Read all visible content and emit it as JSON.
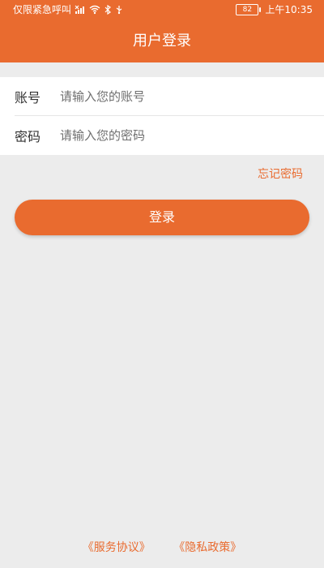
{
  "status_bar": {
    "carrier_text": "仅限紧急呼叫",
    "battery_level": "82",
    "time": "上午10:35",
    "icons": [
      "signal-x-icon",
      "wifi-icon",
      "bluetooth-icon",
      "usb-icon"
    ]
  },
  "header": {
    "title": "用户登录"
  },
  "form": {
    "account_label": "账号",
    "account_placeholder": "请输入您的账号",
    "password_label": "密码",
    "password_placeholder": "请输入您的密码"
  },
  "actions": {
    "forgot_password": "忘记密码",
    "login": "登录"
  },
  "footer": {
    "service_agreement": "《服务协议》",
    "privacy_policy": "《隐私政策》"
  },
  "colors": {
    "accent": "#e96b2f",
    "background": "#ececec",
    "card": "#ffffff"
  }
}
